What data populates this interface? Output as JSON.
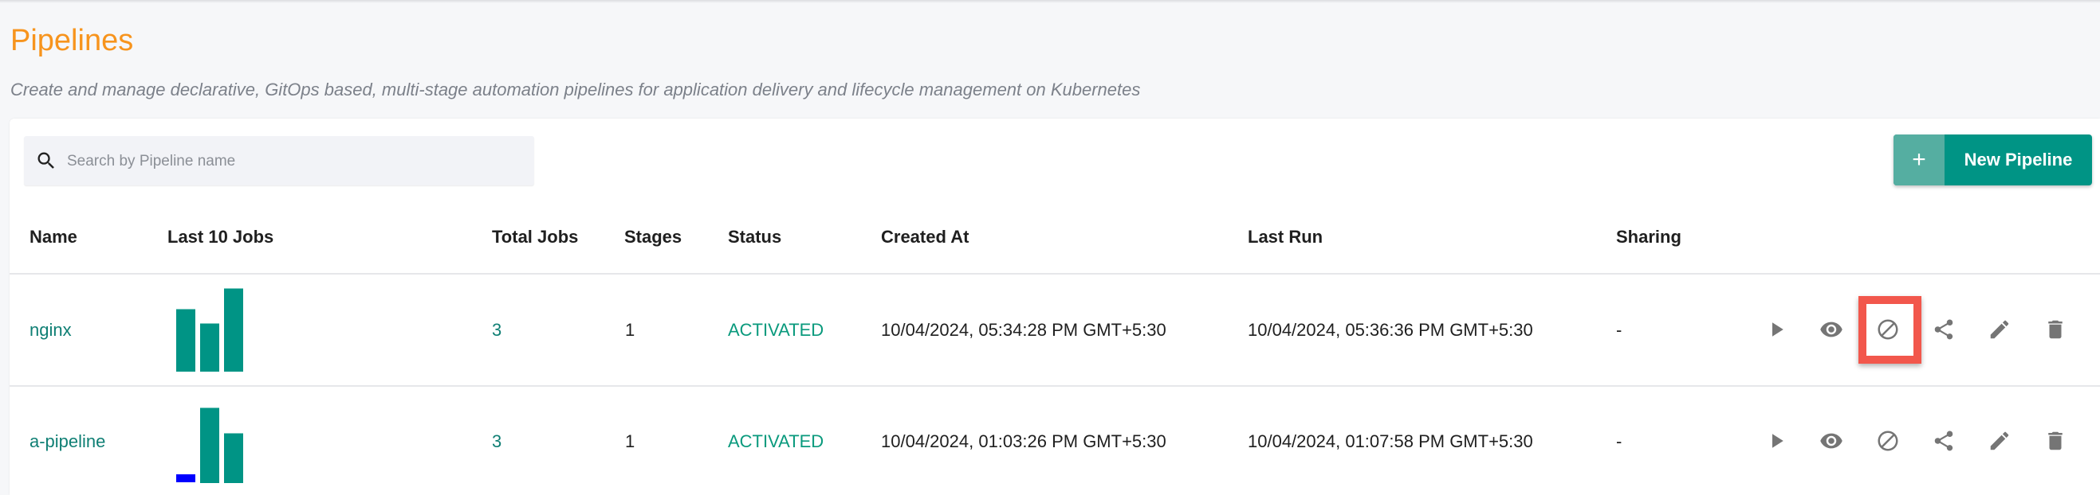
{
  "page": {
    "title": "Pipelines",
    "subtitle": "Create and manage declarative, GitOps based, multi-stage automation pipelines for application delivery and lifecycle management on Kubernetes"
  },
  "search": {
    "placeholder": "Search by Pipeline name",
    "value": "",
    "icon": "search-icon"
  },
  "new_button": {
    "icon": "+",
    "label": "New Pipeline",
    "color": "#009485"
  },
  "table": {
    "columns": [
      "Name",
      "Last 10 Jobs",
      "Total Jobs",
      "Stages",
      "Status",
      "Created At",
      "Last Run",
      "Sharing"
    ],
    "rows": [
      {
        "name": "nginx",
        "last_jobs": [
          {
            "value": 3,
            "status": "success"
          },
          {
            "value": 2.3,
            "status": "success"
          },
          {
            "value": 4,
            "status": "success"
          }
        ],
        "total_jobs": "3",
        "stages": "1",
        "status": "ACTIVATED",
        "created_at": "10/04/2024, 05:34:28 PM GMT+5:30",
        "last_run": "10/04/2024, 05:36:36 PM GMT+5:30",
        "sharing": "-",
        "actions": [
          "play-icon",
          "view-icon",
          "disable-icon",
          "share-icon",
          "edit-icon",
          "delete-icon"
        ],
        "highlighted_action": "disable-icon"
      },
      {
        "name": "a-pipeline",
        "last_jobs": [
          {
            "value": 0.4,
            "status": "running"
          },
          {
            "value": 3.6,
            "status": "success"
          },
          {
            "value": 2.4,
            "status": "success"
          }
        ],
        "total_jobs": "3",
        "stages": "1",
        "status": "ACTIVATED",
        "created_at": "10/04/2024, 01:03:26 PM GMT+5:30",
        "last_run": "10/04/2024, 01:07:58 PM GMT+5:30",
        "sharing": "-",
        "actions": [
          "play-icon",
          "view-icon",
          "disable-icon",
          "share-icon",
          "edit-icon",
          "delete-icon"
        ]
      }
    ]
  },
  "colors": {
    "success": "#009485",
    "running": "#0000ff",
    "title": "#f7941d",
    "highlight": "#f2574c"
  }
}
